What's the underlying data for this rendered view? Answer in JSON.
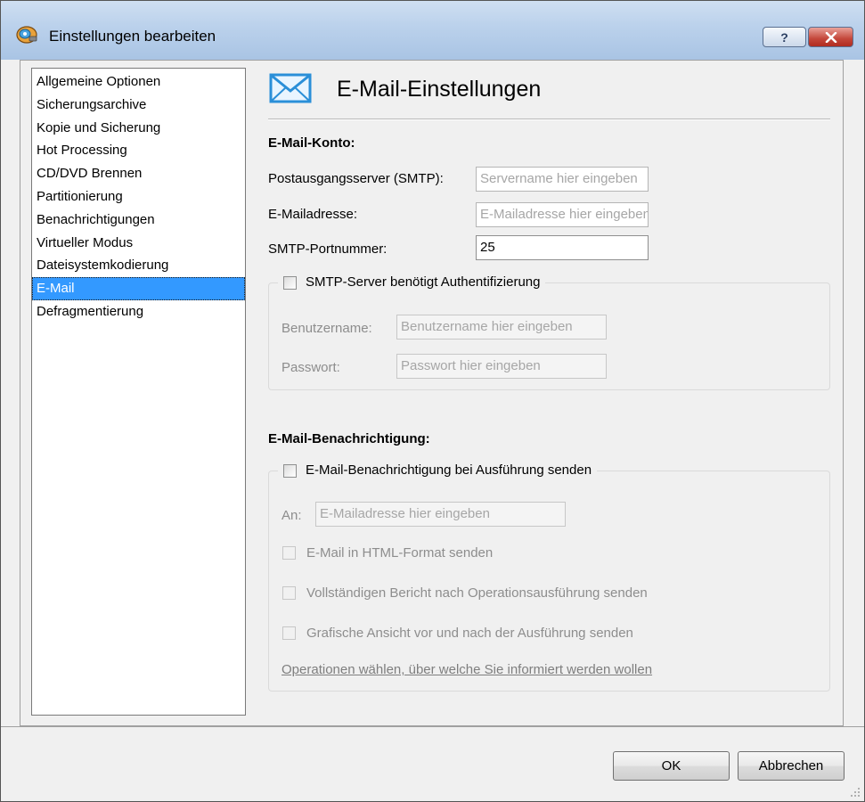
{
  "window": {
    "title": "Einstellungen bearbeiten",
    "help_label": "?"
  },
  "nav": {
    "items": [
      {
        "label": "Allgemeine Optionen"
      },
      {
        "label": "Sicherungsarchive"
      },
      {
        "label": "Kopie und Sicherung"
      },
      {
        "label": "Hot Processing"
      },
      {
        "label": "CD/DVD Brennen"
      },
      {
        "label": "Partitionierung"
      },
      {
        "label": "Benachrichtigungen"
      },
      {
        "label": "Virtueller Modus"
      },
      {
        "label": "Dateisystemkodierung"
      },
      {
        "label": "E-Mail"
      },
      {
        "label": "Defragmentierung"
      }
    ],
    "selected": "E-Mail"
  },
  "header": {
    "title": "E-Mail-Einstellungen",
    "icon": "envelope-icon"
  },
  "account": {
    "title": "E-Mail-Konto:",
    "smtp_label": "Postausgangsserver (SMTP):",
    "smtp_placeholder": "Servername hier eingeben",
    "email_label": "E-Mailadresse:",
    "email_placeholder": "E-Mailadresse hier eingeben",
    "port_label": "SMTP-Portnummer:",
    "port_value": "25",
    "auth_checkbox_label": "SMTP-Server benötigt Authentifizierung",
    "auth_checked": false,
    "user_label": "Benutzername:",
    "user_placeholder": "Benutzername hier eingeben",
    "pass_label": "Passwort:",
    "pass_placeholder": "Passwort hier eingeben"
  },
  "notify": {
    "title": "E-Mail-Benachrichtigung:",
    "send_checkbox_label": "E-Mail-Benachrichtigung bei Ausführung senden",
    "send_checked": false,
    "to_label": "An:",
    "to_placeholder": "E-Mailadresse hier eingeben",
    "html_label": "E-Mail in HTML-Format senden",
    "report_label": "Vollständigen Bericht nach Operationsausführung senden",
    "graphic_label": "Grafische Ansicht vor und nach der Ausführung senden",
    "link_label": "Operationen wählen, über welche Sie informiert werden wollen"
  },
  "buttons": {
    "ok": "OK",
    "cancel": "Abbrechen"
  },
  "colors": {
    "selection": "#3399ff",
    "envelope": "#2a8fd8",
    "close": "#c4463a"
  }
}
